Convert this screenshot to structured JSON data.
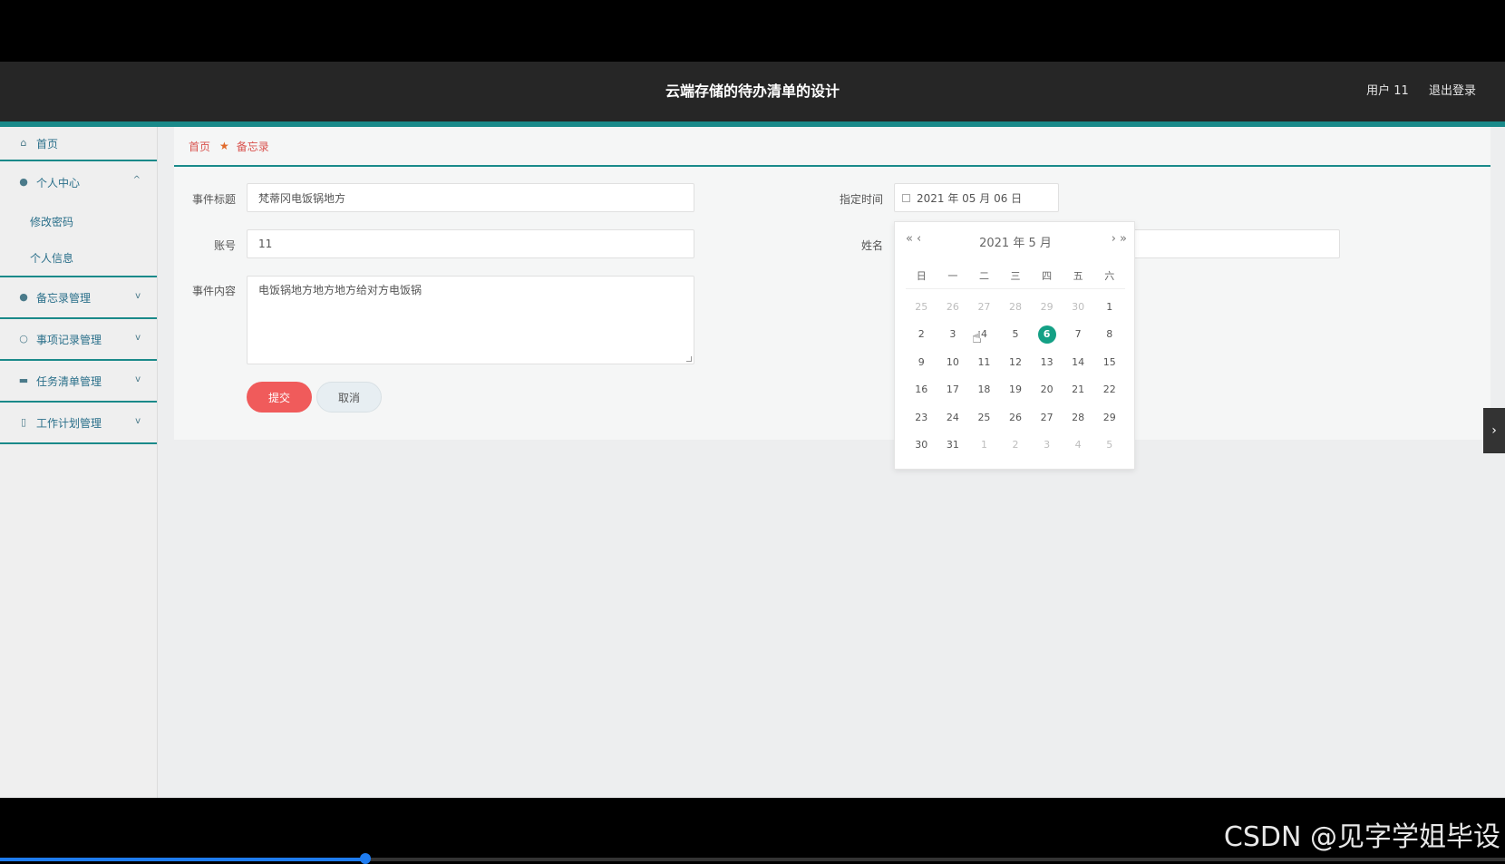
{
  "header": {
    "title": "云端存储的待办清单的设计",
    "user_label": "用户 11",
    "logout_label": "退出登录"
  },
  "sidebar": {
    "home": "首页",
    "personal_center": "个人中心",
    "change_password": "修改密码",
    "personal_info": "个人信息",
    "items": [
      {
        "label": "备忘录管理",
        "icon": "pin-icon"
      },
      {
        "label": "事项记录管理",
        "icon": "compass-icon"
      },
      {
        "label": "任务清单管理",
        "icon": "list-icon"
      },
      {
        "label": "工作计划管理",
        "icon": "phone-icon"
      }
    ]
  },
  "breadcrumb": {
    "home": "首页",
    "current": "备忘录"
  },
  "form": {
    "title_label": "事件标题",
    "title_value": "梵蒂冈电饭锅地方",
    "account_label": "账号",
    "account_value": "11",
    "content_label": "事件内容",
    "content_value": "电饭锅地方地方地方给对方电饭锅",
    "time_label": "指定时间",
    "time_value": "2021 年 05 月 06 日",
    "name_label": "姓名",
    "name_value": "",
    "submit_label": "提交",
    "cancel_label": "取消"
  },
  "calendar": {
    "title": "2021 年  5 月",
    "prev_year": "«",
    "prev_month": "‹",
    "next_month": "›",
    "next_year": "»",
    "weekdays": [
      "日",
      "一",
      "二",
      "三",
      "四",
      "五",
      "六"
    ],
    "weeks": [
      [
        {
          "d": "25",
          "m": true
        },
        {
          "d": "26",
          "m": true
        },
        {
          "d": "27",
          "m": true
        },
        {
          "d": "28",
          "m": true
        },
        {
          "d": "29",
          "m": true
        },
        {
          "d": "30",
          "m": true
        },
        {
          "d": "1"
        }
      ],
      [
        {
          "d": "2"
        },
        {
          "d": "3"
        },
        {
          "d": "4"
        },
        {
          "d": "5"
        },
        {
          "d": "6",
          "sel": true
        },
        {
          "d": "7"
        },
        {
          "d": "8"
        }
      ],
      [
        {
          "d": "9"
        },
        {
          "d": "10"
        },
        {
          "d": "11"
        },
        {
          "d": "12"
        },
        {
          "d": "13"
        },
        {
          "d": "14"
        },
        {
          "d": "15"
        }
      ],
      [
        {
          "d": "16"
        },
        {
          "d": "17"
        },
        {
          "d": "18"
        },
        {
          "d": "19"
        },
        {
          "d": "20"
        },
        {
          "d": "21"
        },
        {
          "d": "22"
        }
      ],
      [
        {
          "d": "23"
        },
        {
          "d": "24"
        },
        {
          "d": "25"
        },
        {
          "d": "26"
        },
        {
          "d": "27"
        },
        {
          "d": "28"
        },
        {
          "d": "29"
        }
      ],
      [
        {
          "d": "30"
        },
        {
          "d": "31"
        },
        {
          "d": "1",
          "m": true
        },
        {
          "d": "2",
          "m": true
        },
        {
          "d": "3",
          "m": true
        },
        {
          "d": "4",
          "m": true
        },
        {
          "d": "5",
          "m": true
        }
      ]
    ]
  },
  "watermark": "CSDN @见字学姐毕设",
  "video_progress": 0.243,
  "colors": {
    "accent": "#1a8a8a",
    "selected_day": "#14a085",
    "submit": "#f05b5b"
  }
}
